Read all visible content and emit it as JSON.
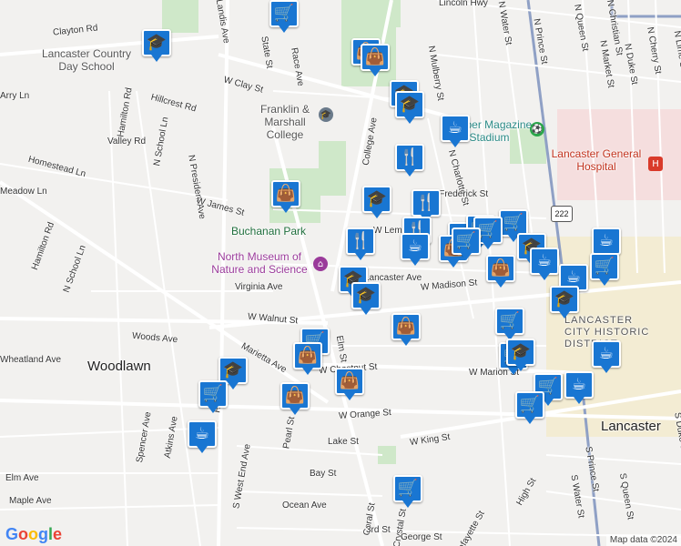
{
  "map": {
    "streets": [
      "Clayton Rd",
      "Landis Ave",
      "State St",
      "Race Ave",
      "W Clay St",
      "Hillcrest Rd",
      "Hamilton Rd",
      "N School Ln",
      "N President Ave",
      "Valley Rd",
      "Homestead Ln",
      "W James St",
      "Hamilton Rd",
      "N School Ln",
      "Virginia Ave",
      "W Walnut St",
      "Woods Ave",
      "Marietta Ave",
      "W Chestnut St",
      "W Orange St",
      "W King St",
      "Lake St",
      "Bay St",
      "Ocean Ave",
      "Elm Ave",
      "Maple Ave",
      "Spencer Ave",
      "Atkins Ave",
      "Pearl St",
      "S West End Ave",
      "Elm St",
      "Coral St",
      "Crystal St",
      "Lafayette St",
      "High St",
      "George St",
      "3rd St",
      "College Ave",
      "N Mulberry St",
      "N Charlotte St",
      "W Madison St",
      "W Marion St",
      "N Water St",
      "N Prince St",
      "N Queen St",
      "N Christian St",
      "N Duke St",
      "N Cherry St",
      "N Lime St",
      "N Market St",
      "Lincoln Hwy",
      "S Prince St",
      "S Water St",
      "S Queen St",
      "S Duke St",
      "W Frederick St",
      "W Lemon St",
      "Lancaster Ave",
      "Harrison Ave",
      "Arry Ln",
      "Meadow Ln",
      "Wheatland Ave"
    ],
    "places": {
      "day_school": "Lancaster Country Day School",
      "college": "Franklin & Marshall College",
      "park": "Buchanan Park",
      "museum": "North Museum of Nature and Science",
      "stadium": "Clipper Magazine Stadium",
      "hospital": "Lancaster General Hospital",
      "district": "LANCASTER CITY HISTORIC DISTRICT",
      "woodlawn": "Woodlawn",
      "city": "Lancaster"
    },
    "route_shield": "222",
    "markers": [
      {
        "icon": "cart"
      },
      {
        "icon": "school"
      },
      {
        "icon": "bag"
      },
      {
        "icon": "bag"
      },
      {
        "icon": "school"
      },
      {
        "icon": "school"
      },
      {
        "icon": "cafe"
      },
      {
        "icon": "restaurant"
      },
      {
        "icon": "school"
      },
      {
        "icon": "restaurant"
      },
      {
        "icon": "bag"
      },
      {
        "icon": "restaurant"
      },
      {
        "icon": "restaurant"
      },
      {
        "icon": "cafe"
      },
      {
        "icon": "cart"
      },
      {
        "icon": "cart"
      },
      {
        "icon": "bag"
      },
      {
        "icon": "cart"
      },
      {
        "icon": "cart"
      },
      {
        "icon": "cart"
      },
      {
        "icon": "school"
      },
      {
        "icon": "cafe"
      },
      {
        "icon": "bag"
      },
      {
        "icon": "cafe"
      },
      {
        "icon": "cafe"
      },
      {
        "icon": "cart"
      },
      {
        "icon": "school"
      },
      {
        "icon": "school"
      },
      {
        "icon": "school"
      },
      {
        "icon": "bag"
      },
      {
        "icon": "cart"
      },
      {
        "icon": "cart"
      },
      {
        "icon": "bag"
      },
      {
        "icon": "bag"
      },
      {
        "icon": "bag"
      },
      {
        "icon": "school"
      },
      {
        "icon": "cart"
      },
      {
        "icon": "cafe"
      },
      {
        "icon": "cart"
      },
      {
        "icon": "school"
      },
      {
        "icon": "cart"
      },
      {
        "icon": "cafe"
      },
      {
        "icon": "cart"
      },
      {
        "icon": "cart"
      },
      {
        "icon": "cafe"
      }
    ],
    "attribution": "Map data ©2024",
    "logo": "Google"
  }
}
